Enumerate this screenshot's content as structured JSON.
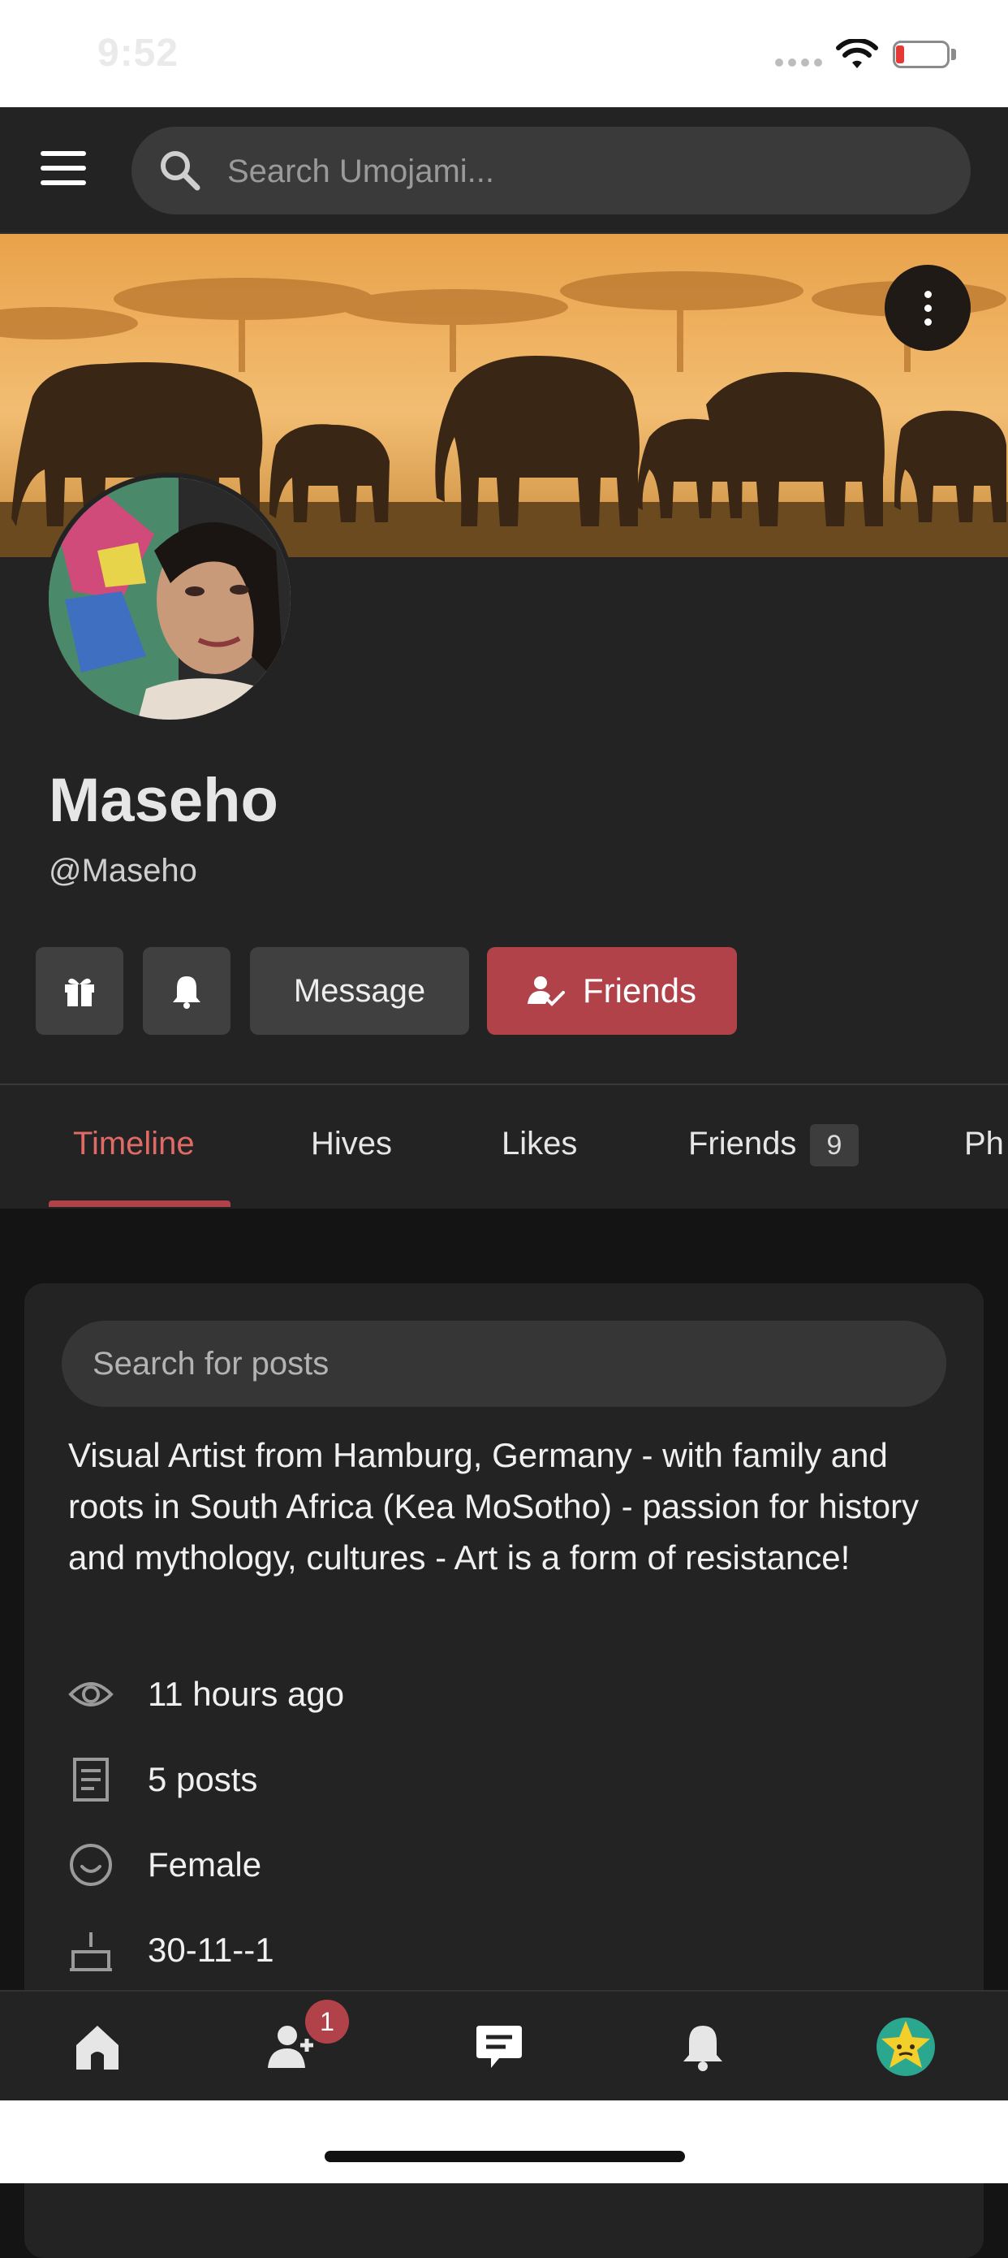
{
  "status_bar": {
    "time": "9:52"
  },
  "search": {
    "placeholder": "Search Umojami..."
  },
  "profile": {
    "name": "Maseho",
    "handle": "@Maseho"
  },
  "actions": {
    "message_label": "Message",
    "friends_label": "Friends"
  },
  "tabs": [
    {
      "label": "Timeline",
      "active": true
    },
    {
      "label": "Hives"
    },
    {
      "label": "Likes"
    },
    {
      "label": "Friends",
      "count": "9"
    },
    {
      "label": "Ph"
    }
  ],
  "timeline": {
    "search_placeholder": "Search for posts",
    "bio": "Visual Artist from Hamburg, Germany - with family and roots in South Africa (Kea MoSotho) - passion for history and mythology, cultures - Art is a form of resistance!",
    "info": [
      {
        "icon": "eye-icon",
        "text": "11 hours ago"
      },
      {
        "icon": "document-icon",
        "text": "5 posts"
      },
      {
        "icon": "smiley-icon",
        "text": "Female"
      },
      {
        "icon": "cake-icon",
        "text": "30-11--1"
      }
    ]
  },
  "bottom_nav": {
    "friend_requests_badge": "1"
  },
  "colors": {
    "accent": "#b1424a",
    "active_tab": "#e06b66",
    "surface": "#232323",
    "background": "#141414"
  }
}
